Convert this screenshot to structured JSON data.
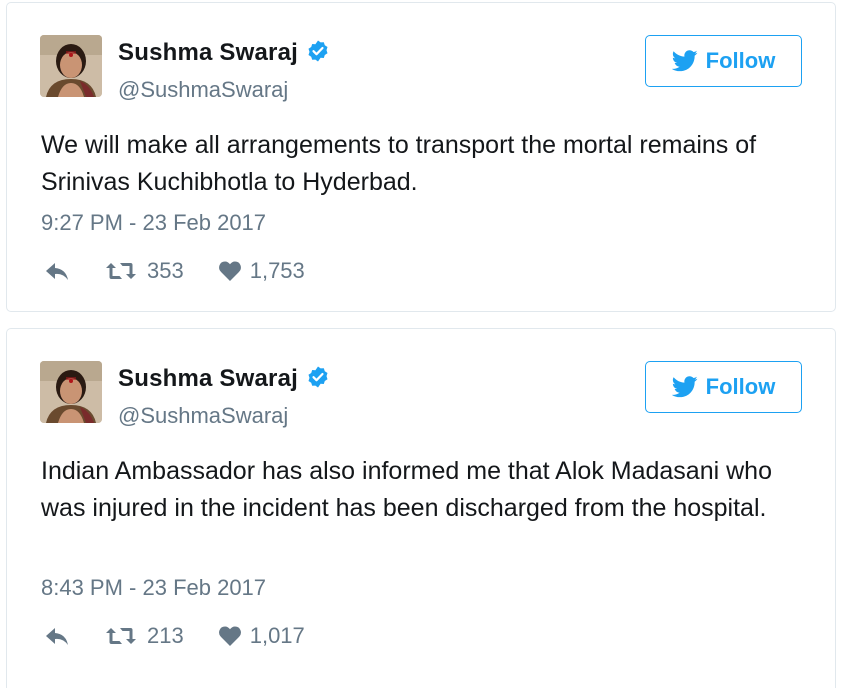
{
  "colors": {
    "accent": "#1da1f2",
    "text": "#14171a",
    "muted": "#657786",
    "border": "#e1e8ed"
  },
  "tweets": [
    {
      "author": {
        "name": "Sushma Swaraj",
        "handle": "@SushmaSwaraj",
        "verified_icon": "verified-badge-icon"
      },
      "follow_label": "Follow",
      "text": "We will make all arrangements to transport the mortal remains of Srinivas Kuchibhotla to Hyderbad.",
      "timestamp": "9:27 PM - 23 Feb 2017",
      "retweets": "353",
      "likes": "1,753"
    },
    {
      "author": {
        "name": "Sushma Swaraj",
        "handle": "@SushmaSwaraj",
        "verified_icon": "verified-badge-icon"
      },
      "follow_label": "Follow",
      "text": "Indian Ambassador has also informed me that Alok Madasani who was injured in the incident has been discharged from the hospital.",
      "timestamp": "8:43 PM - 23 Feb 2017",
      "retweets": "213",
      "likes": "1,017"
    }
  ]
}
